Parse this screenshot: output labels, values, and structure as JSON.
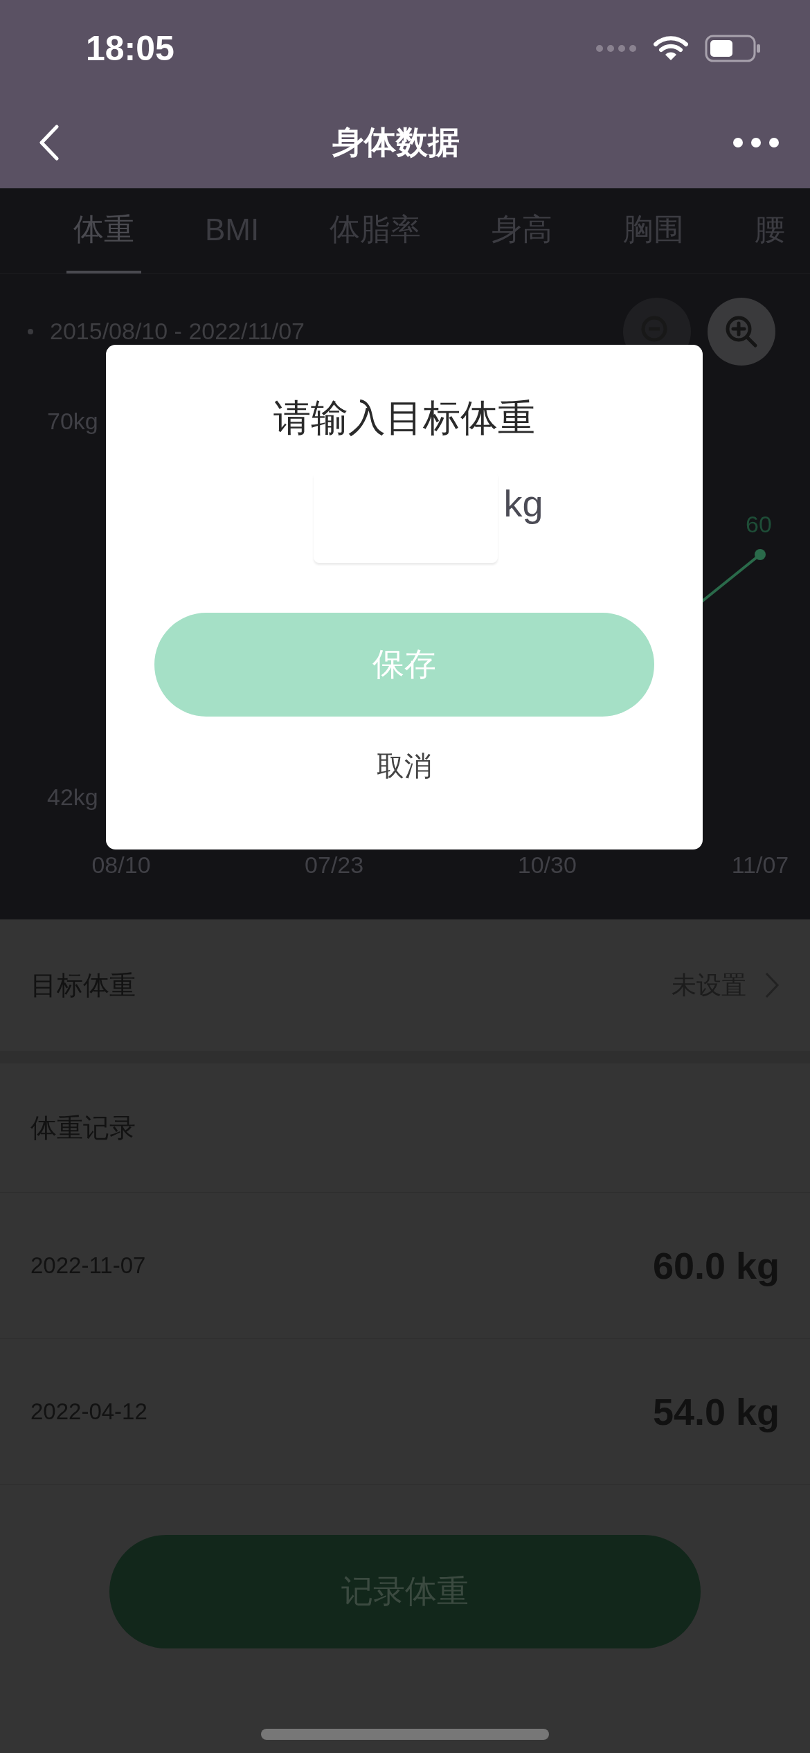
{
  "status_bar": {
    "time": "18:05"
  },
  "nav": {
    "title": "身体数据"
  },
  "tabs": [
    {
      "label": "体重",
      "selected": true
    },
    {
      "label": "BMI",
      "selected": false
    },
    {
      "label": "体脂率",
      "selected": false
    },
    {
      "label": "身高",
      "selected": false
    },
    {
      "label": "胸围",
      "selected": false
    },
    {
      "label": "腰",
      "selected": false
    }
  ],
  "chart": {
    "date_range": "2015/08/10 - 2022/11/07",
    "y_labels": [
      "70kg",
      "42kg"
    ],
    "x_labels": [
      "08/10",
      "07/23",
      "10/30",
      "11/07"
    ],
    "point_label": "60"
  },
  "target": {
    "label": "目标体重",
    "value": "未设置"
  },
  "records": {
    "title": "体重记录",
    "rows": [
      {
        "date": "2022-11-07",
        "weight": "60.0 kg"
      },
      {
        "date": "2022-04-12",
        "weight": "54.0 kg"
      }
    ]
  },
  "record_button": "记录体重",
  "dialog": {
    "title": "请输入目标体重",
    "unit": "kg",
    "save": "保存",
    "cancel": "取消"
  }
}
